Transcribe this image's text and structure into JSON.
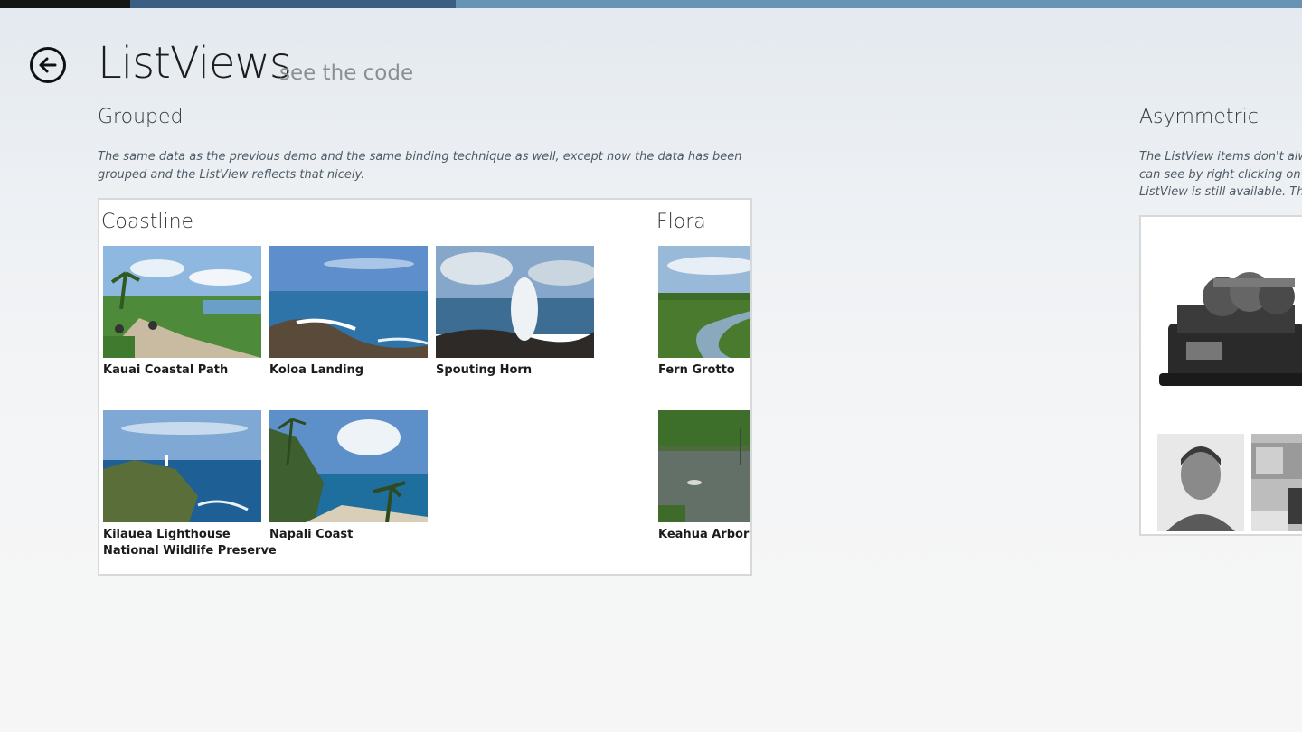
{
  "header": {
    "title": "ListViews",
    "subtitle": "see the code"
  },
  "grouped": {
    "title": "Grouped",
    "description_line1": "The same data as the previous demo and the same binding technique as well, except now the data has been",
    "description_line2": "grouped and the ListView reflects that nicely.",
    "groups": [
      {
        "name": "Coastline",
        "items": [
          {
            "label": "Kauai Coastal Path"
          },
          {
            "label": "Koloa Landing"
          },
          {
            "label": "Spouting Horn"
          },
          {
            "label": "Kilauea Lighthouse",
            "label_line2": "National Wildlife Preserve"
          },
          {
            "label": "Napali Coast"
          }
        ]
      },
      {
        "name": "Flora",
        "items": [
          {
            "label": "Fern Grotto"
          },
          {
            "label": "Keahua Arboretu"
          }
        ]
      }
    ]
  },
  "asymmetric": {
    "title": "Asymmetric",
    "description_line1": "The ListView items don't alw",
    "description_line2": "can see by right clicking on",
    "description_line3": "ListView is still available. Th"
  },
  "colors": {
    "topbar_dark": "#151515",
    "topbar_mid": "#3b5f82",
    "topbar_light": "#6894b4",
    "accent_text": "#4e5a66"
  },
  "icons": {
    "back": "back-arrow-icon"
  }
}
